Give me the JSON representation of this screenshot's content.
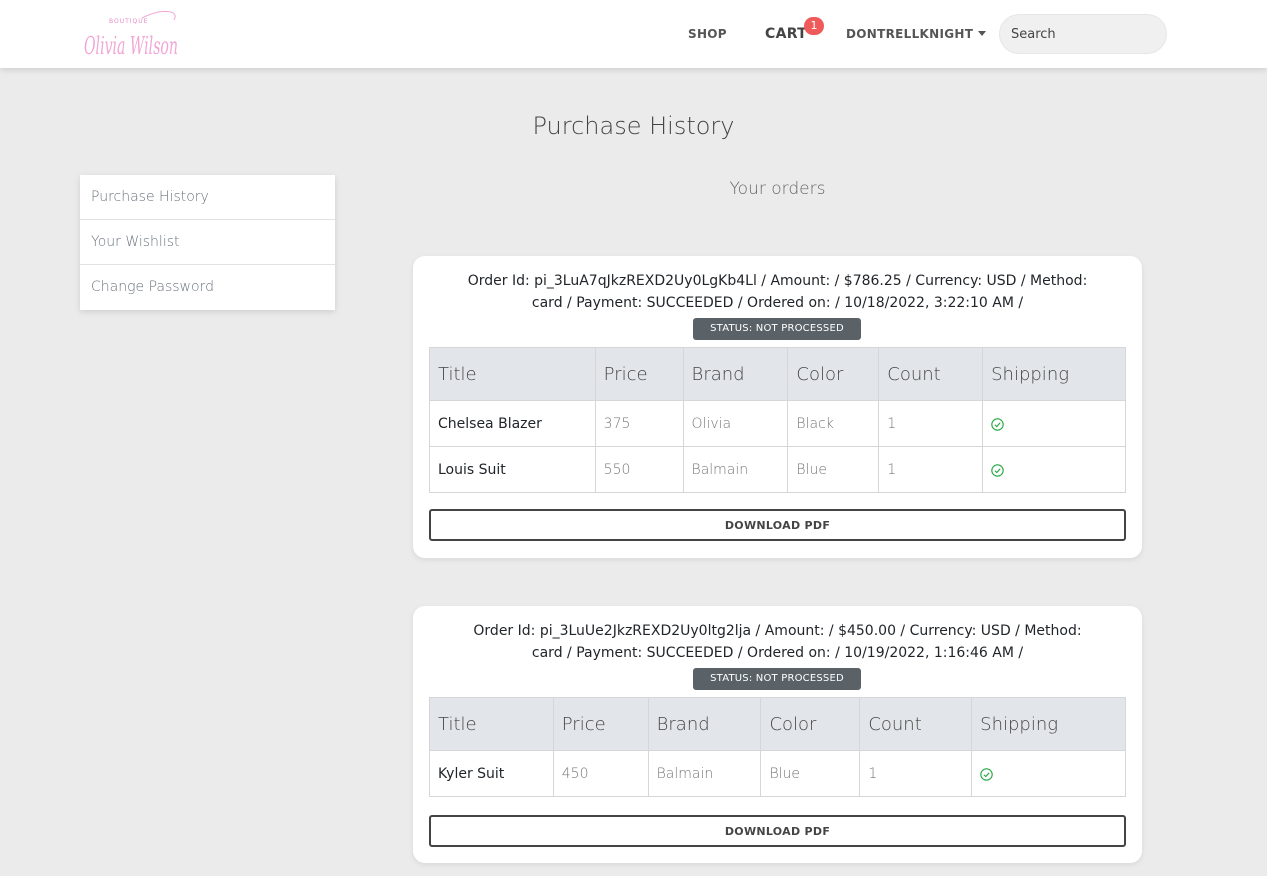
{
  "brand": {
    "logo_alt": "Olivia Wilson Boutique",
    "logo_small": "BOUTIQUE",
    "logo_script": "Olivia Wilson"
  },
  "nav": {
    "shop": "SHOP",
    "cart": "CART",
    "cart_count": "1",
    "user": "DONTRELLKNIGHT",
    "search_placeholder": "Search"
  },
  "page": {
    "title": "Purchase History",
    "subtitle": "Your orders"
  },
  "sidebar": {
    "items": [
      {
        "label": "Purchase History"
      },
      {
        "label": "Your Wishlist"
      },
      {
        "label": "Change Password"
      }
    ]
  },
  "table_headers": [
    "Title",
    "Price",
    "Brand",
    "Color",
    "Count",
    "Shipping"
  ],
  "orders": [
    {
      "info_line1": "Order Id: pi_3LuA7qJkzREXD2Uy0LgKb4Ll / Amount: / $786.25 / Currency: USD / Method:",
      "info_line2": "card / Payment: SUCCEEDED / Ordered on: / 10/18/2022, 3:22:10 AM /",
      "status": "STATUS: NOT PROCESSED",
      "download_label": "DOWNLOAD PDF",
      "items": [
        {
          "title": "Chelsea Blazer",
          "price": "375",
          "brand": "Olivia",
          "color": "Black",
          "count": "1",
          "shipping_icon": "check-circle-icon"
        },
        {
          "title": "Louis Suit",
          "price": "550",
          "brand": "Balmain",
          "color": "Blue",
          "count": "1",
          "shipping_icon": "check-circle-icon"
        }
      ]
    },
    {
      "info_line1": "Order Id: pi_3LuUe2JkzREXD2Uy0ltg2lja / Amount: / $450.00 / Currency: USD / Method:",
      "info_line2": "card / Payment: SUCCEEDED / Ordered on: / 10/19/2022, 1:16:46 AM /",
      "status": "STATUS: NOT PROCESSED",
      "download_label": "DOWNLOAD PDF",
      "items": [
        {
          "title": "Kyler Suit",
          "price": "450",
          "brand": "Balmain",
          "color": "Blue",
          "count": "1",
          "shipping_icon": "check-circle-icon"
        }
      ]
    }
  ],
  "colors": {
    "check": "#28a745",
    "badge": "#5a6268",
    "cart_badge": "#ef5b5b",
    "logo": "#f2a6d6"
  }
}
